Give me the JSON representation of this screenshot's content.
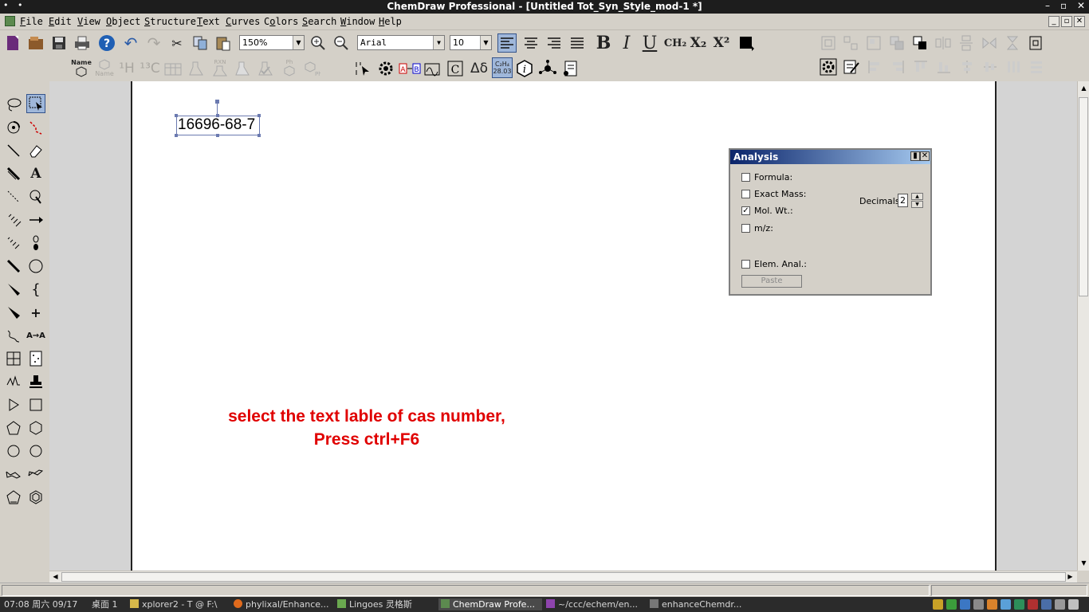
{
  "window": {
    "title": "ChemDraw Professional - [Untitled Tot_Syn_Style_mod-1 *]",
    "controls": [
      "–",
      "▫",
      "✕"
    ]
  },
  "menubar": {
    "items": [
      {
        "label": "File",
        "accel": "F"
      },
      {
        "label": "Edit",
        "accel": "E"
      },
      {
        "label": "View",
        "accel": "V"
      },
      {
        "label": "Object",
        "accel": "O"
      },
      {
        "label": "Structure",
        "accel": "S"
      },
      {
        "label": "Text",
        "accel": "T"
      },
      {
        "label": "Curves",
        "accel": "C"
      },
      {
        "label": "Colors",
        "accel": "o"
      },
      {
        "label": "Search",
        "accel": "S"
      },
      {
        "label": "Window",
        "accel": "W"
      },
      {
        "label": "Help",
        "accel": "H"
      }
    ],
    "mdi_controls": [
      "_",
      "▫",
      "✕"
    ]
  },
  "toolbar": {
    "zoom_value": "150%",
    "font_value": "Arial",
    "size_value": "10",
    "bold_label": "B",
    "italic_label": "I",
    "underline_label": "U",
    "ch2_label": "CH₂",
    "subscript_label": "X₂",
    "superscript_label": "X²",
    "name_label": "Name",
    "name_sub_label": "Name",
    "rxn_label": "RXN",
    "ph_label": "Ph",
    "formula_label": "C₂H₄",
    "formula_mass": "28.03",
    "atob_label": "A→B",
    "delta_label": "Δδ",
    "c_label": "C"
  },
  "palette": {
    "text_tool": "A",
    "atob_tool": "A→A",
    "plus_tool": "+"
  },
  "document": {
    "cas_number": "16696-68-7",
    "instruction_line1": "select the text lable of cas number,",
    "instruction_line2": "Press ctrl+F6",
    "instruction_color": "#e00000"
  },
  "analysis": {
    "title": "Analysis",
    "checkboxes": [
      {
        "label": "Formula:",
        "checked": false
      },
      {
        "label": "Exact Mass:",
        "checked": false
      },
      {
        "label": "Mol. Wt.:",
        "checked": true
      },
      {
        "label": "m/z:",
        "checked": false
      },
      {
        "label": "Elem. Anal.:",
        "checked": false
      }
    ],
    "decimals_label": "Decimals:",
    "decimals_value": "2",
    "paste_label": "Paste"
  },
  "taskbar": {
    "clock": "07:08 周六 09/17",
    "desktop": "桌面 1",
    "items": [
      {
        "label": "xplorer2 - T @ F:\\"
      },
      {
        "label": "phylixal/Enhance..."
      },
      {
        "label": "Lingoes 灵格斯"
      },
      {
        "label": "ChemDraw Profe..."
      },
      {
        "label": "~/ccc/echem/en..."
      },
      {
        "label": "enhanceChemdr..."
      }
    ]
  },
  "colors": {
    "selection": "#6b7ab0",
    "title_gradient_start": "#0a246a",
    "active_tool": "#9fb7da"
  }
}
